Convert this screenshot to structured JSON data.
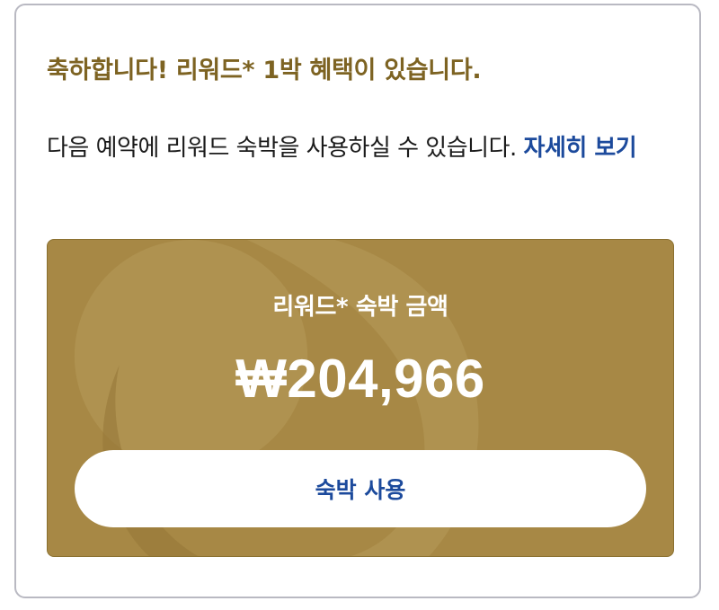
{
  "reward_notice": {
    "headline": "축하합니다! 리워드* 1박 혜택이 있습니다.",
    "description": "다음 예약에 리워드 숙박을 사용하실 수 있습니다.",
    "details_link": "자세히 보기"
  },
  "reward_card": {
    "label": "리워드* 숙박 금액",
    "amount": "₩204,966",
    "button_label": "숙박 사용"
  },
  "colors": {
    "headline": "#7d6322",
    "card_background": "#a78845",
    "link": "#1c4a9c"
  }
}
